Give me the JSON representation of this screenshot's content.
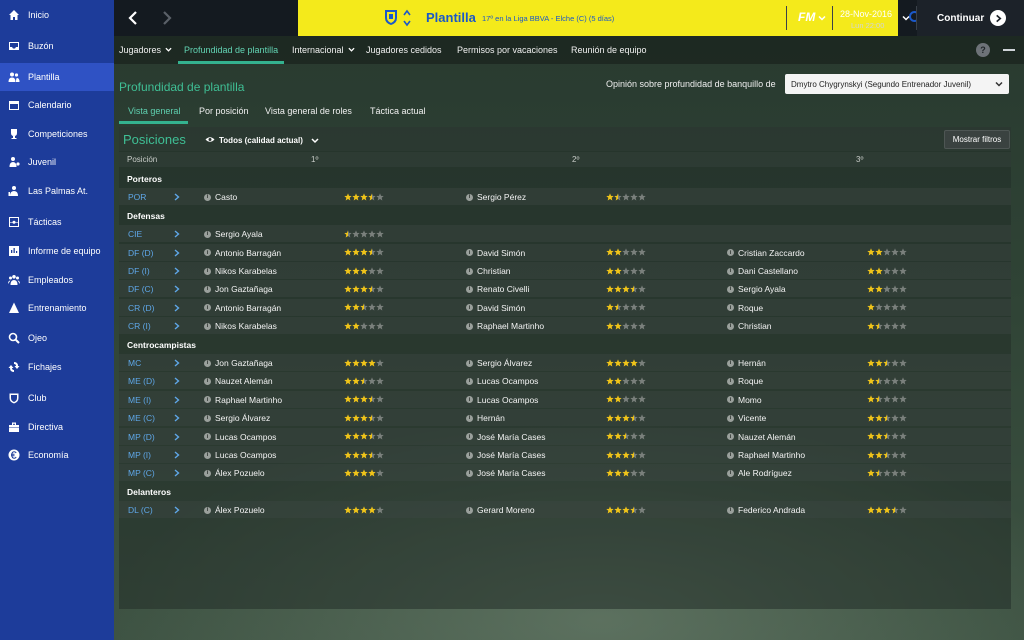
{
  "colors": {
    "sidebar": "#1d3c9a",
    "sidebar_active": "#2f52c4",
    "club_bar": "#f4ea1b",
    "club_text": "#1a58c9",
    "accent_green": "#3fbf95",
    "position_blue": "#5fa7e8",
    "star_filled": "#f0c419",
    "star_empty": "#7a807c"
  },
  "sidebar": {
    "items": [
      {
        "label": "Inicio",
        "icon": "home-icon"
      },
      {
        "label": "Buzón",
        "icon": "inbox-icon"
      },
      {
        "label": "Plantilla",
        "icon": "squad-icon",
        "active": true
      },
      {
        "label": "Calendario",
        "icon": "calendar-icon"
      },
      {
        "label": "Competiciones",
        "icon": "trophy-icon"
      },
      {
        "label": "Juvenil",
        "icon": "youth-icon"
      },
      {
        "label": "Las Palmas At.",
        "icon": "reserve-team-icon"
      },
      {
        "label": "Tácticas",
        "icon": "tactics-icon"
      },
      {
        "label": "Informe de equipo",
        "icon": "report-icon"
      },
      {
        "label": "Empleados",
        "icon": "staff-icon"
      },
      {
        "label": "Entrenamiento",
        "icon": "training-icon"
      },
      {
        "label": "Ojeo",
        "icon": "scouting-icon"
      },
      {
        "label": "Fichajes",
        "icon": "transfers-icon"
      },
      {
        "label": "Club",
        "icon": "club-icon"
      },
      {
        "label": "Directiva",
        "icon": "board-icon"
      },
      {
        "label": "Economía",
        "icon": "finances-icon"
      }
    ]
  },
  "header": {
    "title": "Plantilla",
    "subtitle": "17º en la Liga BBVA - Elche (C) (5 días)",
    "game_logo": "FM",
    "date": "28-Nov-2016",
    "day_time": "Lun 22:00",
    "continue_label": "Continuar"
  },
  "subnav": {
    "tabs": [
      "Jugadores",
      "Profundidad de plantilla",
      "Internacional",
      "Jugadores cedidos",
      "Permisos por vacaciones",
      "Reunión de equipo"
    ],
    "help": "?"
  },
  "page": {
    "title": "Profundidad de plantilla",
    "opinion_label": "Opinión sobre profundidad de banquillo de",
    "opinion_value": "Dmytro Chygrynskyi (Segundo Entrenador Juvenil)",
    "tabs": [
      "Vista general",
      "Por posición",
      "Vista general de roles",
      "Táctica actual"
    ]
  },
  "panel": {
    "title": "Posiciones",
    "filter": "Todos (calidad actual)",
    "show_filters": "Mostrar filtros",
    "columns": [
      "Posición",
      "1º",
      "2º",
      "3º"
    ]
  },
  "sections": [
    {
      "title": "Porteros",
      "rows": [
        {
          "pos": "POR",
          "p1": "Casto",
          "s1": 3.5,
          "p2": "Sergio Pérez",
          "s2": 1.5,
          "p3": "",
          "s3": null
        }
      ]
    },
    {
      "title": "Defensas",
      "rows": [
        {
          "pos": "CIE",
          "p1": "Sergio Ayala",
          "s1": 0.5,
          "p2": "",
          "s2": null,
          "p3": "",
          "s3": null
        },
        {
          "pos": "DF (D)",
          "p1": "Antonio Barragán",
          "s1": 3.5,
          "p2": "David Simón",
          "s2": 2,
          "p3": "Cristian Zaccardo",
          "s3": 2
        },
        {
          "pos": "DF (I)",
          "p1": "Nikos Karabelas",
          "s1": 3,
          "p2": "Christian",
          "s2": 2,
          "p3": "Dani Castellano",
          "s3": 2
        },
        {
          "pos": "DF (C)",
          "p1": "Jon Gaztañaga",
          "s1": 3.5,
          "p2": "Renato Civelli",
          "s2": 3.5,
          "p3": "Sergio Ayala",
          "s3": 2
        },
        {
          "pos": "CR (D)",
          "p1": "Antonio Barragán",
          "s1": 2.5,
          "p2": "David Simón",
          "s2": 1.5,
          "p3": "Roque",
          "s3": 1
        },
        {
          "pos": "CR (I)",
          "p1": "Nikos Karabelas",
          "s1": 2,
          "p2": "Raphael Martinho",
          "s2": 2,
          "p3": "Christian",
          "s3": 1.5
        }
      ]
    },
    {
      "title": "Centrocampistas",
      "rows": [
        {
          "pos": "MC",
          "p1": "Jon Gaztañaga",
          "s1": 4,
          "p2": "Sergio Álvarez",
          "s2": 4,
          "p3": "Hernán",
          "s3": 2.5
        },
        {
          "pos": "ME (D)",
          "p1": "Nauzet Alemán",
          "s1": 2.5,
          "p2": "Lucas Ocampos",
          "s2": 2,
          "p3": "Roque",
          "s3": 1.5
        },
        {
          "pos": "ME (I)",
          "p1": "Raphael Martinho",
          "s1": 3.5,
          "p2": "Lucas Ocampos",
          "s2": 2,
          "p3": "Momo",
          "s3": 1.5
        },
        {
          "pos": "ME (C)",
          "p1": "Sergio Álvarez",
          "s1": 3.5,
          "p2": "Hernán",
          "s2": 3.5,
          "p3": "Vicente",
          "s3": 2.5
        },
        {
          "pos": "MP (D)",
          "p1": "Lucas Ocampos",
          "s1": 3.5,
          "p2": "José María Cases",
          "s2": 2.5,
          "p3": "Nauzet Alemán",
          "s3": 2.5
        },
        {
          "pos": "MP (I)",
          "p1": "Lucas Ocampos",
          "s1": 3.5,
          "p2": "José María Cases",
          "s2": 3.5,
          "p3": "Raphael Martinho",
          "s3": 2.5
        },
        {
          "pos": "MP (C)",
          "p1": "Álex Pozuelo",
          "s1": 4,
          "p2": "José María Cases",
          "s2": 3,
          "p3": "Ale Rodríguez",
          "s3": 1.5
        }
      ]
    },
    {
      "title": "Delanteros",
      "rows": [
        {
          "pos": "DL (C)",
          "p1": "Álex Pozuelo",
          "s1": 4,
          "p2": "Gerard Moreno",
          "s2": 3.5,
          "p3": "Federico Andrada",
          "s3": 3.5
        }
      ]
    }
  ]
}
